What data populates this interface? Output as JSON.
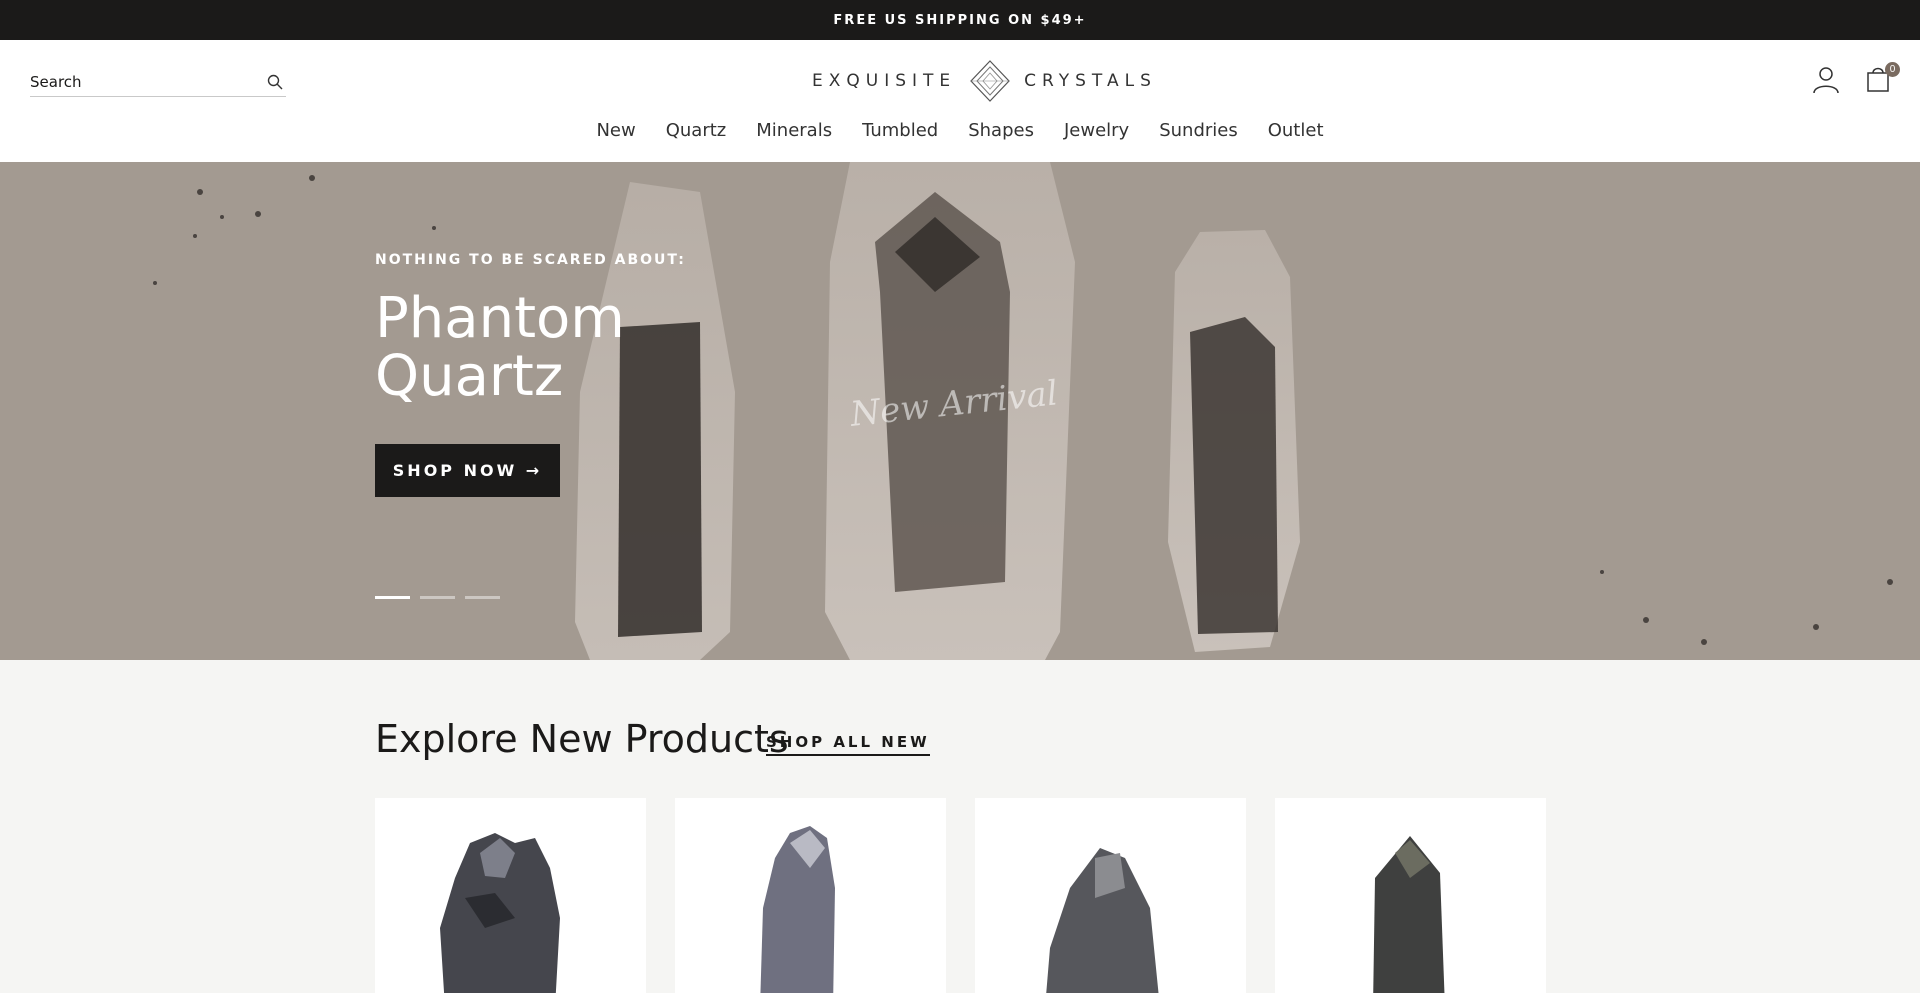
{
  "announcement": "FREE US SHIPPING ON $49+",
  "header": {
    "search_placeholder": "Search",
    "logo_left": "EXQUISITE",
    "logo_right": "CRYSTALS",
    "cart_count": "0",
    "icons": {
      "search": "search-icon",
      "account": "user-icon",
      "cart": "shopping-bag-icon",
      "logo": "diamond-logo-icon"
    }
  },
  "nav": {
    "items": [
      {
        "label": "New"
      },
      {
        "label": "Quartz"
      },
      {
        "label": "Minerals"
      },
      {
        "label": "Tumbled"
      },
      {
        "label": "Shapes"
      },
      {
        "label": "Jewelry"
      },
      {
        "label": "Sundries"
      },
      {
        "label": "Outlet"
      }
    ]
  },
  "hero": {
    "kicker": "NOTHING TO BE SCARED ABOUT:",
    "title": "Phantom Quartz",
    "cta": "SHOP NOW →",
    "overlay_text": "New Arrival",
    "slides_total": 3,
    "active_slide": 1
  },
  "products": {
    "title": "Explore New Products",
    "link": "SHOP ALL NEW",
    "cards_visible": 4
  },
  "colors": {
    "dark": "#1b1a19",
    "hero_bg": "#a39a91",
    "page_bg": "#f5f5f3"
  }
}
